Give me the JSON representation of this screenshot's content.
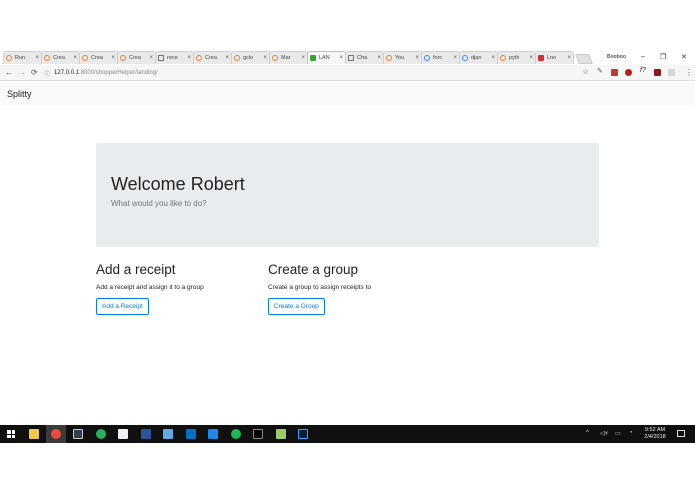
{
  "browser": {
    "tabs": [
      {
        "label": "Run",
        "favicon": "chrome-spinner-icon"
      },
      {
        "label": "Crea",
        "favicon": "chrome-spinner-icon"
      },
      {
        "label": "Crea",
        "favicon": "chrome-spinner-icon"
      },
      {
        "label": "Crea",
        "favicon": "chrome-spinner-icon"
      },
      {
        "label": "rece",
        "favicon": "document-icon"
      },
      {
        "label": "Crea",
        "favicon": "chrome-spinner-icon"
      },
      {
        "label": "gclo",
        "favicon": "chrome-spinner-icon"
      },
      {
        "label": "Mar",
        "favicon": "chrome-spinner-icon"
      },
      {
        "label": "LAN",
        "favicon": "leaf-icon",
        "active": true
      },
      {
        "label": "Cha",
        "favicon": "document-icon"
      },
      {
        "label": "You",
        "favicon": "chrome-spinner-icon"
      },
      {
        "label": "forc",
        "favicon": "google-icon"
      },
      {
        "label": "djan",
        "favicon": "google-icon"
      },
      {
        "label": "pyth",
        "favicon": "star-icon"
      },
      {
        "label": "Lno",
        "favicon": "red-square-icon"
      }
    ],
    "profile_name": "Booboo",
    "window_controls": {
      "minimize": "–",
      "restore": "❐",
      "close": "✕"
    },
    "url_host": "127.0.0.1",
    "url_rest": ":8000/shopperHelper/landing/",
    "nav": {
      "back": "←",
      "forward": "→",
      "reload": "⟳"
    },
    "star": "☆"
  },
  "page": {
    "brand": "Splitty",
    "jumbotron": {
      "title": "Welcome Robert",
      "subtitle": "What would you like to do?"
    },
    "receipt": {
      "heading": "Add a receipt",
      "description": "Add a receipt and assign it to a group",
      "button": "Add a Receipt"
    },
    "group": {
      "heading": "Create a group",
      "description": "Create a group to assign receipts to",
      "button": "Create a Group"
    }
  },
  "taskbar": {
    "time": "9:52 AM",
    "date": "2/4/2018",
    "tray_chevron": "^",
    "accent": "#101010"
  },
  "colors": {
    "primary": "#007bff",
    "jumbotron_bg": "#e9ecef",
    "navbar_bg": "#f8f9fa",
    "muted": "#6c757d"
  }
}
